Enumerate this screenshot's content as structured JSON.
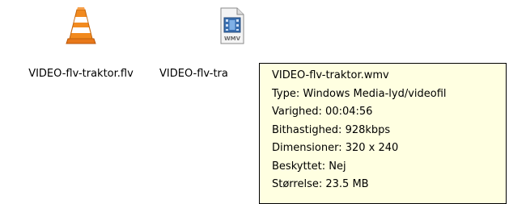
{
  "files": [
    {
      "label": "VIDEO-flv-traktor.flv",
      "icon": "vlc-cone-icon"
    },
    {
      "label": "VIDEO-flv-tra",
      "icon": "wmv-file-icon",
      "icon_badge": "WMV"
    }
  ],
  "tooltip": {
    "lines": [
      "VIDEO-flv-traktor.wmv",
      "Type: Windows Media-lyd/videofil",
      "Varighed: 00:04:56",
      "Bithastighed: 928kbps",
      "Dimensioner: 320 x 240",
      "Beskyttet: Nej",
      "Størrelse: 23.5 MB"
    ],
    "background": "#ffffe1"
  }
}
